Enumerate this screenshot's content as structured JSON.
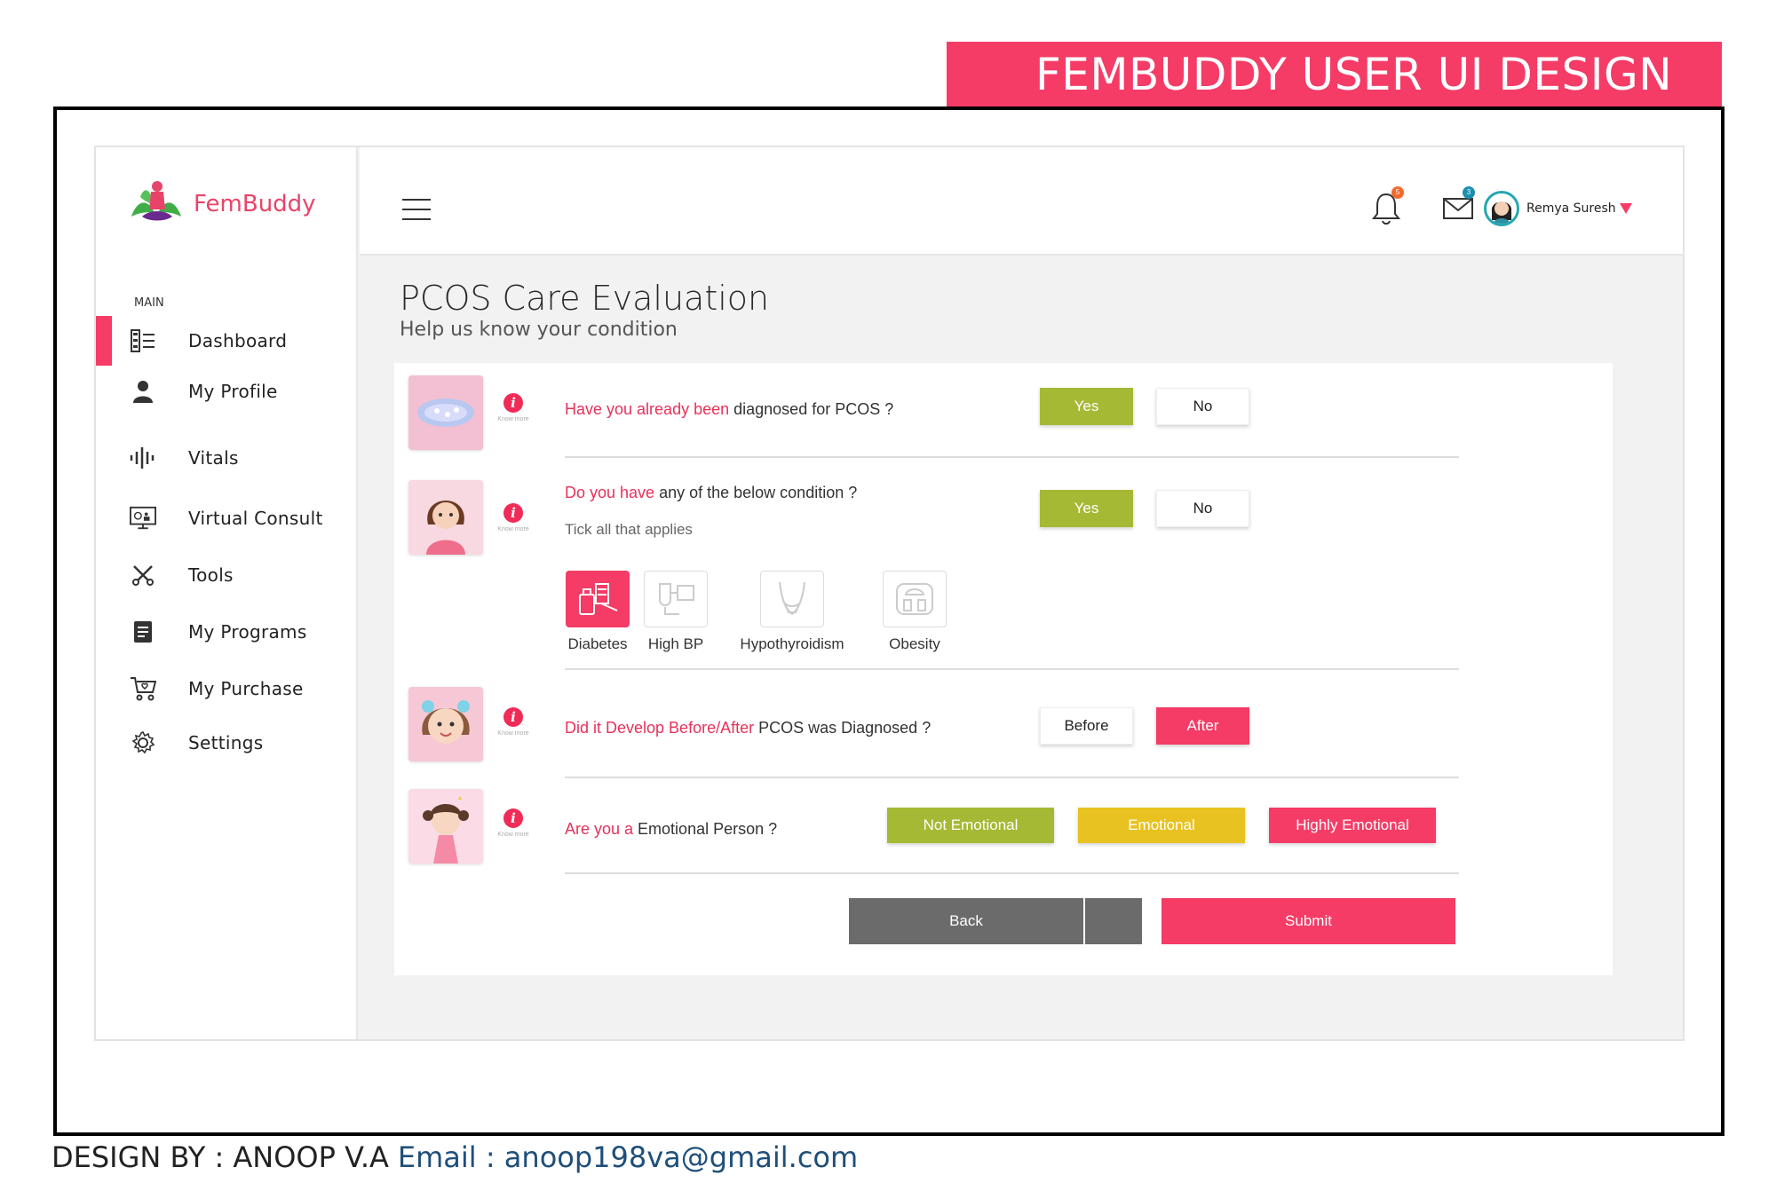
{
  "banner": {
    "title": "FEMBUDDY USER  UI DESIGN"
  },
  "app": {
    "logo_text": "FemBuddy",
    "section_label": "MAIN",
    "nav": [
      {
        "label": "Dashboard",
        "icon": "dashboard-icon",
        "active": true
      },
      {
        "label": "My Profile",
        "icon": "user-icon",
        "active": false
      },
      {
        "label": "Vitals",
        "icon": "vitals-icon",
        "active": false
      },
      {
        "label": "Virtual Consult",
        "icon": "monitor-icon",
        "active": false
      },
      {
        "label": "Tools",
        "icon": "tools-icon",
        "active": false
      },
      {
        "label": "My Programs",
        "icon": "programs-icon",
        "active": false
      },
      {
        "label": "My Purchase",
        "icon": "cart-icon",
        "active": false
      },
      {
        "label": "Settings",
        "icon": "gear-icon",
        "active": false
      }
    ],
    "topbar": {
      "notifications_badge": "5",
      "messages_badge": "3",
      "user_name": "Remya Suresh"
    }
  },
  "page": {
    "title": "PCOS Care Evaluation",
    "subtitle": "Help us know your condition",
    "know_more": "Know more",
    "questions": {
      "q1": {
        "highlight": "Have you already been",
        "text": " diagnosed for PCOS ?",
        "yes": "Yes",
        "no": "No",
        "selected": "Yes"
      },
      "q2": {
        "highlight": "Do you have",
        "text": " any of the below condition ?",
        "hint": "Tick all that applies",
        "yes": "Yes",
        "no": "No",
        "selected": "Yes",
        "conditions": [
          {
            "label": "Diabetes",
            "selected": true
          },
          {
            "label": "High BP",
            "selected": false
          },
          {
            "label": "Hypothyroidism",
            "selected": false
          },
          {
            "label": "Obesity",
            "selected": false
          }
        ]
      },
      "q3": {
        "highlight": "Did it Develop Before/After",
        "text": " PCOS was Diagnosed ?",
        "before": "Before",
        "after": "After",
        "selected": "After"
      },
      "q4": {
        "highlight": "Are you a",
        "text": "  Emotional Person ?",
        "options": [
          "Not Emotional",
          "Emotional",
          "Highly Emotional"
        ]
      }
    },
    "actions": {
      "back": "Back",
      "submit": "Submit"
    }
  },
  "footer": {
    "designer": "DESIGN BY : ANOOP V.A",
    "email": "Email : anoop198va@gmail.com"
  },
  "colors": {
    "accent": "#f43c66",
    "green": "#a5b934",
    "yellow": "#e8c221",
    "grey": "#6b6b6b"
  }
}
